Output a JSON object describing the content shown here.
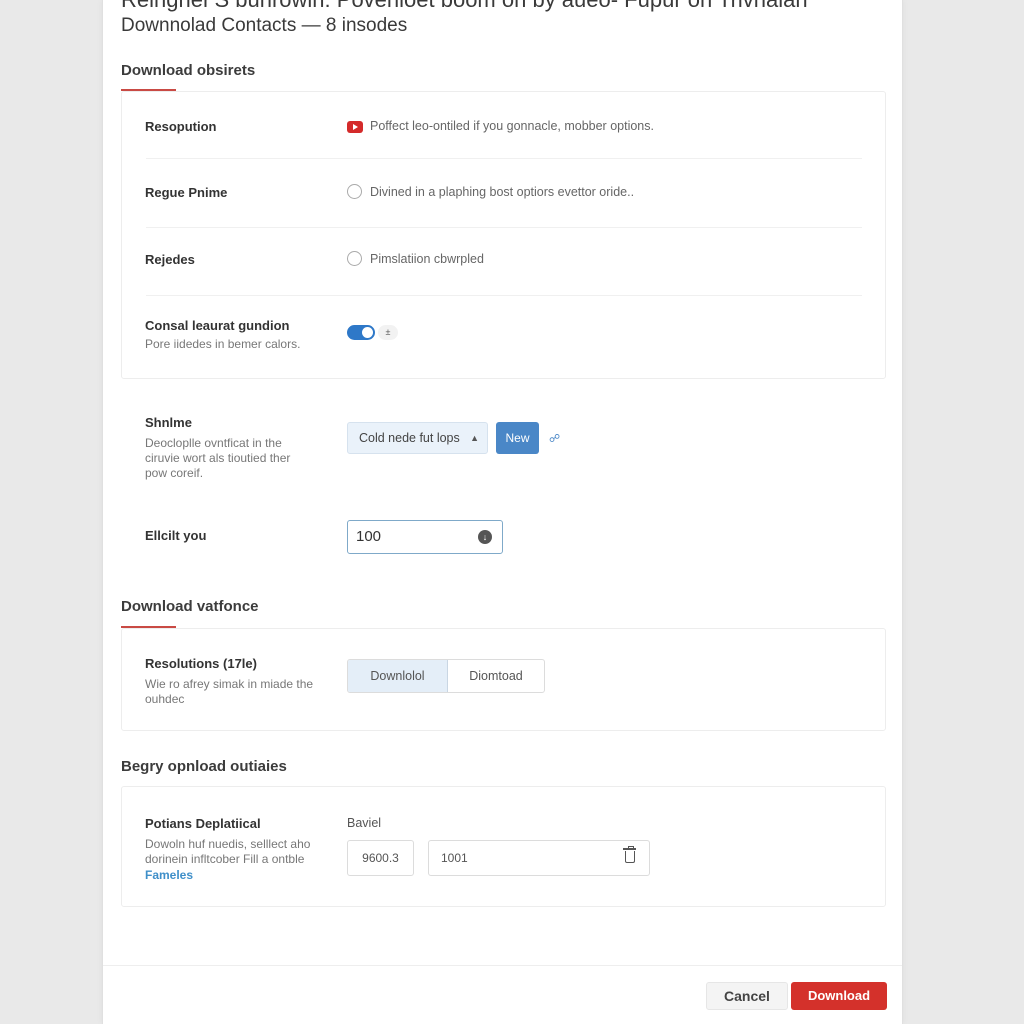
{
  "dialog": {
    "clipped_title": "Reingner'S bunrowin: Povenioet boom on by aueo- Fupur on Trivnalan",
    "title": "Downnolad Contacts — 8 insodes"
  },
  "sections": {
    "options": {
      "heading": "Download obsirets",
      "rows": {
        "resolution": {
          "label": "Resopution",
          "option_text": "Poffect leo-ontiled if you gonnacle, mobber options.",
          "icon": "youtube-play-icon"
        },
        "regue_prime": {
          "label": "Regue Pnime",
          "option_text": "Divined in a plaphing bost optiors evettor oride.."
        },
        "rejedes": {
          "label": "Rejedes",
          "option_text": "Pimslatiion cbwrpled"
        },
        "consal": {
          "label": "Consal leaurat gundion",
          "description": "Pore iidedes in bemer calors.",
          "toggle_on": true,
          "toggle_hint": "±"
        }
      },
      "shnime": {
        "label": "Shnlme",
        "description": "Deocloplle ovntficat in the ciruvie wort als tioutied ther pow coreif.",
        "select_value": "Cold nede fut lops",
        "new_button": "New",
        "link_icon": "link-icon"
      },
      "ellcit": {
        "label": "Ellcilt you",
        "value": "100"
      }
    },
    "variance": {
      "heading": "Download vatfonce",
      "label": "Resolutions (17le)",
      "description": "Wie ro afrey simak in miade the ouhdec",
      "segments": [
        "Downlolol",
        "Diomtoad"
      ],
      "active_segment": 0
    },
    "outputs": {
      "heading": "Begry opnload outiaies",
      "label": "Potians Deplatiical",
      "description": "Dowoln huf nuedis, selllect aho dorinein infltcober Fill a ontble",
      "link": "Fameles",
      "field_label": "Baviel",
      "small_value": "9600.3",
      "wide_value": "1001"
    }
  },
  "footer": {
    "cancel": "Cancel",
    "download": "Download"
  },
  "colors": {
    "accent_red": "#d4312b",
    "accent_blue": "#4a87c7",
    "toggle_blue": "#2e78c8"
  }
}
